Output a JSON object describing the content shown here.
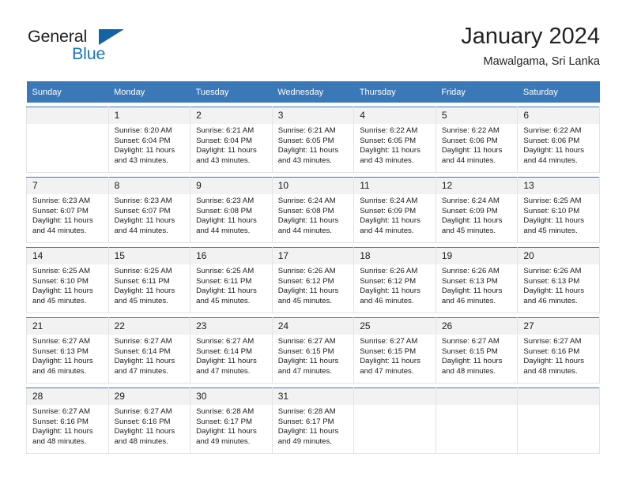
{
  "brand": {
    "word1": "General",
    "word2": "Blue",
    "triangle_color": "#1464a5",
    "word1_color": "#231f20",
    "word2_color": "#1b75bb"
  },
  "header": {
    "title": "January 2024",
    "subtitle": "Mawalgama, Sri Lanka",
    "header_bg": "#3b78b7",
    "daynum_bg": "#f2f2f2"
  },
  "weekday_headers": [
    "Sunday",
    "Monday",
    "Tuesday",
    "Wednesday",
    "Thursday",
    "Friday",
    "Saturday"
  ],
  "labels": {
    "sunrise_prefix": "Sunrise:",
    "sunset_prefix": "Sunset:",
    "daylight_prefix": "Daylight:"
  },
  "weeks": [
    [
      {
        "day": "",
        "sunrise": "",
        "sunset": "",
        "daylight_l1": "",
        "daylight_l2": ""
      },
      {
        "day": "1",
        "sunrise": "Sunrise: 6:20 AM",
        "sunset": "Sunset: 6:04 PM",
        "daylight_l1": "Daylight: 11 hours",
        "daylight_l2": "and 43 minutes."
      },
      {
        "day": "2",
        "sunrise": "Sunrise: 6:21 AM",
        "sunset": "Sunset: 6:04 PM",
        "daylight_l1": "Daylight: 11 hours",
        "daylight_l2": "and 43 minutes."
      },
      {
        "day": "3",
        "sunrise": "Sunrise: 6:21 AM",
        "sunset": "Sunset: 6:05 PM",
        "daylight_l1": "Daylight: 11 hours",
        "daylight_l2": "and 43 minutes."
      },
      {
        "day": "4",
        "sunrise": "Sunrise: 6:22 AM",
        "sunset": "Sunset: 6:05 PM",
        "daylight_l1": "Daylight: 11 hours",
        "daylight_l2": "and 43 minutes."
      },
      {
        "day": "5",
        "sunrise": "Sunrise: 6:22 AM",
        "sunset": "Sunset: 6:06 PM",
        "daylight_l1": "Daylight: 11 hours",
        "daylight_l2": "and 44 minutes."
      },
      {
        "day": "6",
        "sunrise": "Sunrise: 6:22 AM",
        "sunset": "Sunset: 6:06 PM",
        "daylight_l1": "Daylight: 11 hours",
        "daylight_l2": "and 44 minutes."
      }
    ],
    [
      {
        "day": "7",
        "sunrise": "Sunrise: 6:23 AM",
        "sunset": "Sunset: 6:07 PM",
        "daylight_l1": "Daylight: 11 hours",
        "daylight_l2": "and 44 minutes."
      },
      {
        "day": "8",
        "sunrise": "Sunrise: 6:23 AM",
        "sunset": "Sunset: 6:07 PM",
        "daylight_l1": "Daylight: 11 hours",
        "daylight_l2": "and 44 minutes."
      },
      {
        "day": "9",
        "sunrise": "Sunrise: 6:23 AM",
        "sunset": "Sunset: 6:08 PM",
        "daylight_l1": "Daylight: 11 hours",
        "daylight_l2": "and 44 minutes."
      },
      {
        "day": "10",
        "sunrise": "Sunrise: 6:24 AM",
        "sunset": "Sunset: 6:08 PM",
        "daylight_l1": "Daylight: 11 hours",
        "daylight_l2": "and 44 minutes."
      },
      {
        "day": "11",
        "sunrise": "Sunrise: 6:24 AM",
        "sunset": "Sunset: 6:09 PM",
        "daylight_l1": "Daylight: 11 hours",
        "daylight_l2": "and 44 minutes."
      },
      {
        "day": "12",
        "sunrise": "Sunrise: 6:24 AM",
        "sunset": "Sunset: 6:09 PM",
        "daylight_l1": "Daylight: 11 hours",
        "daylight_l2": "and 45 minutes."
      },
      {
        "day": "13",
        "sunrise": "Sunrise: 6:25 AM",
        "sunset": "Sunset: 6:10 PM",
        "daylight_l1": "Daylight: 11 hours",
        "daylight_l2": "and 45 minutes."
      }
    ],
    [
      {
        "day": "14",
        "sunrise": "Sunrise: 6:25 AM",
        "sunset": "Sunset: 6:10 PM",
        "daylight_l1": "Daylight: 11 hours",
        "daylight_l2": "and 45 minutes."
      },
      {
        "day": "15",
        "sunrise": "Sunrise: 6:25 AM",
        "sunset": "Sunset: 6:11 PM",
        "daylight_l1": "Daylight: 11 hours",
        "daylight_l2": "and 45 minutes."
      },
      {
        "day": "16",
        "sunrise": "Sunrise: 6:25 AM",
        "sunset": "Sunset: 6:11 PM",
        "daylight_l1": "Daylight: 11 hours",
        "daylight_l2": "and 45 minutes."
      },
      {
        "day": "17",
        "sunrise": "Sunrise: 6:26 AM",
        "sunset": "Sunset: 6:12 PM",
        "daylight_l1": "Daylight: 11 hours",
        "daylight_l2": "and 45 minutes."
      },
      {
        "day": "18",
        "sunrise": "Sunrise: 6:26 AM",
        "sunset": "Sunset: 6:12 PM",
        "daylight_l1": "Daylight: 11 hours",
        "daylight_l2": "and 46 minutes."
      },
      {
        "day": "19",
        "sunrise": "Sunrise: 6:26 AM",
        "sunset": "Sunset: 6:13 PM",
        "daylight_l1": "Daylight: 11 hours",
        "daylight_l2": "and 46 minutes."
      },
      {
        "day": "20",
        "sunrise": "Sunrise: 6:26 AM",
        "sunset": "Sunset: 6:13 PM",
        "daylight_l1": "Daylight: 11 hours",
        "daylight_l2": "and 46 minutes."
      }
    ],
    [
      {
        "day": "21",
        "sunrise": "Sunrise: 6:27 AM",
        "sunset": "Sunset: 6:13 PM",
        "daylight_l1": "Daylight: 11 hours",
        "daylight_l2": "and 46 minutes."
      },
      {
        "day": "22",
        "sunrise": "Sunrise: 6:27 AM",
        "sunset": "Sunset: 6:14 PM",
        "daylight_l1": "Daylight: 11 hours",
        "daylight_l2": "and 47 minutes."
      },
      {
        "day": "23",
        "sunrise": "Sunrise: 6:27 AM",
        "sunset": "Sunset: 6:14 PM",
        "daylight_l1": "Daylight: 11 hours",
        "daylight_l2": "and 47 minutes."
      },
      {
        "day": "24",
        "sunrise": "Sunrise: 6:27 AM",
        "sunset": "Sunset: 6:15 PM",
        "daylight_l1": "Daylight: 11 hours",
        "daylight_l2": "and 47 minutes."
      },
      {
        "day": "25",
        "sunrise": "Sunrise: 6:27 AM",
        "sunset": "Sunset: 6:15 PM",
        "daylight_l1": "Daylight: 11 hours",
        "daylight_l2": "and 47 minutes."
      },
      {
        "day": "26",
        "sunrise": "Sunrise: 6:27 AM",
        "sunset": "Sunset: 6:15 PM",
        "daylight_l1": "Daylight: 11 hours",
        "daylight_l2": "and 48 minutes."
      },
      {
        "day": "27",
        "sunrise": "Sunrise: 6:27 AM",
        "sunset": "Sunset: 6:16 PM",
        "daylight_l1": "Daylight: 11 hours",
        "daylight_l2": "and 48 minutes."
      }
    ],
    [
      {
        "day": "28",
        "sunrise": "Sunrise: 6:27 AM",
        "sunset": "Sunset: 6:16 PM",
        "daylight_l1": "Daylight: 11 hours",
        "daylight_l2": "and 48 minutes."
      },
      {
        "day": "29",
        "sunrise": "Sunrise: 6:27 AM",
        "sunset": "Sunset: 6:16 PM",
        "daylight_l1": "Daylight: 11 hours",
        "daylight_l2": "and 48 minutes."
      },
      {
        "day": "30",
        "sunrise": "Sunrise: 6:28 AM",
        "sunset": "Sunset: 6:17 PM",
        "daylight_l1": "Daylight: 11 hours",
        "daylight_l2": "and 49 minutes."
      },
      {
        "day": "31",
        "sunrise": "Sunrise: 6:28 AM",
        "sunset": "Sunset: 6:17 PM",
        "daylight_l1": "Daylight: 11 hours",
        "daylight_l2": "and 49 minutes."
      },
      {
        "day": "",
        "sunrise": "",
        "sunset": "",
        "daylight_l1": "",
        "daylight_l2": ""
      },
      {
        "day": "",
        "sunrise": "",
        "sunset": "",
        "daylight_l1": "",
        "daylight_l2": ""
      },
      {
        "day": "",
        "sunrise": "",
        "sunset": "",
        "daylight_l1": "",
        "daylight_l2": ""
      }
    ]
  ]
}
